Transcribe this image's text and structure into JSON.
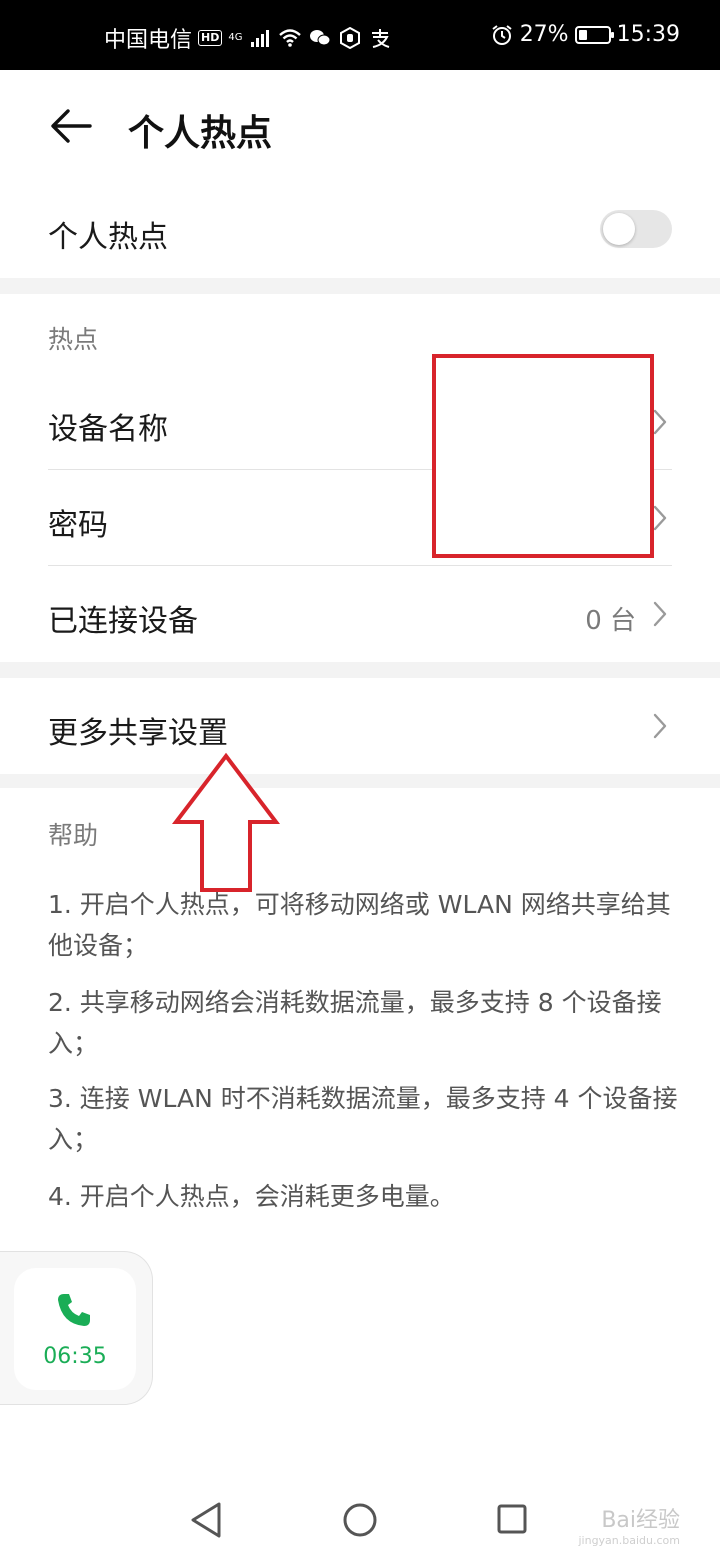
{
  "status_bar": {
    "carrier": "中国电信",
    "hd": "HD",
    "network": "4G",
    "battery_percent": "27%",
    "battery_level": 0.27,
    "time": "15:39"
  },
  "header": {
    "title": "个人热点"
  },
  "hotspot_toggle": {
    "label": "个人热点",
    "enabled": false
  },
  "hotspot_section": {
    "heading": "热点",
    "items": [
      {
        "label": "设备名称",
        "value": ""
      },
      {
        "label": "密码",
        "value": ""
      },
      {
        "label": "已连接设备",
        "value": "0 台"
      }
    ]
  },
  "more_sharing": {
    "label": "更多共享设置"
  },
  "help": {
    "heading": "帮助",
    "paragraphs": [
      "1. 开启个人热点，可将移动网络或 WLAN 网络共享给其他设备；",
      "2. 共享移动网络会消耗数据流量，最多支持 8 个设备接入；",
      "3. 连接 WLAN 时不消耗数据流量，最多支持 4 个设备接入；",
      "4. 开启个人热点，会消耗更多电量。"
    ]
  },
  "call_bubble": {
    "duration": "06:35"
  },
  "watermark": {
    "brand": "Bai经验",
    "url": "jingyan.baidu.com"
  },
  "colors": {
    "accent_green": "#1aad56",
    "annotation_red": "#d8242b",
    "band_gray": "#f3f3f3"
  }
}
